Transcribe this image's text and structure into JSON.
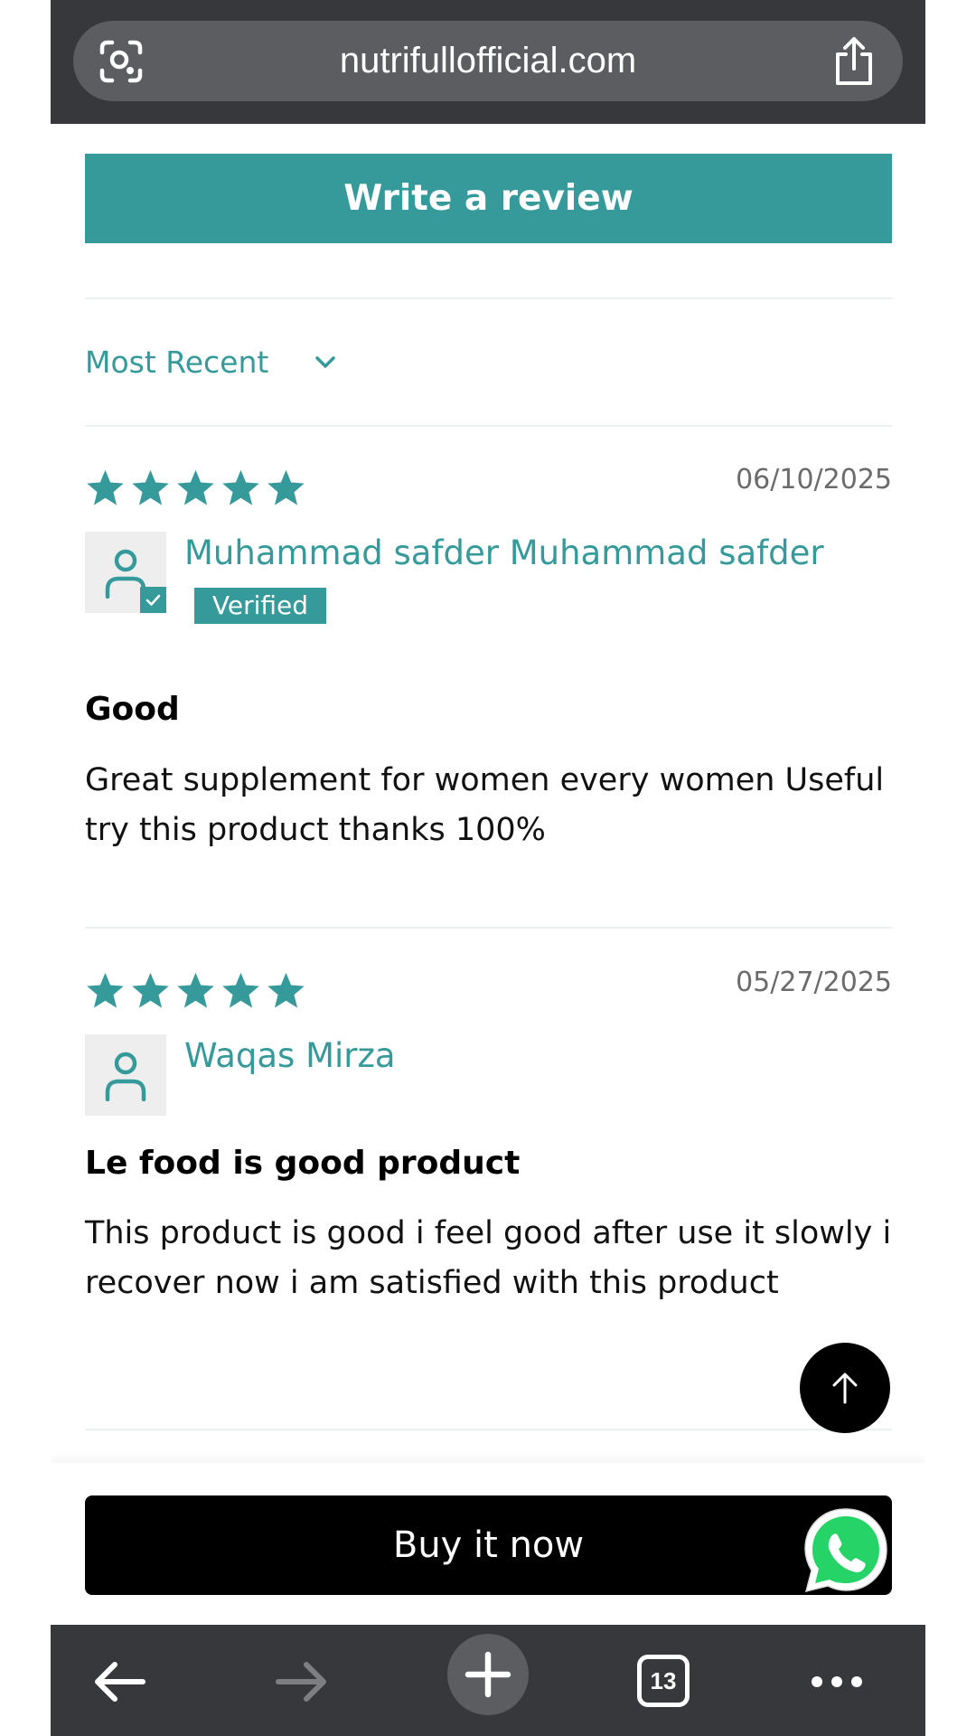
{
  "browser": {
    "url": "nutrifullofficial.com",
    "tabs_count": "13",
    "icons": [
      "lens-icon",
      "share-icon",
      "back-arrow-icon",
      "forward-arrow-icon",
      "plus-icon",
      "tabs-icon",
      "more-icon"
    ]
  },
  "actions": {
    "write_review": "Write a review",
    "buy_now": "Buy it now"
  },
  "sort": {
    "label": "Most Recent"
  },
  "reviews": [
    {
      "rating": 5,
      "date": "06/10/2025",
      "author": "Muhammad safder Muhammad safder",
      "verified_label": "Verified",
      "title": "Good",
      "body": "Great supplement for women every women Useful try this product thanks 100%"
    },
    {
      "rating": 5,
      "date": "05/27/2025",
      "author": "Waqas Mirza",
      "title": "Le food is good product",
      "body": "This product is good i feel good after use it slowly i recover now i am satisfied with this product"
    }
  ],
  "colors": {
    "accent": "#359a99",
    "browser_bar": "#37383b",
    "whatsapp": "#25d366"
  }
}
